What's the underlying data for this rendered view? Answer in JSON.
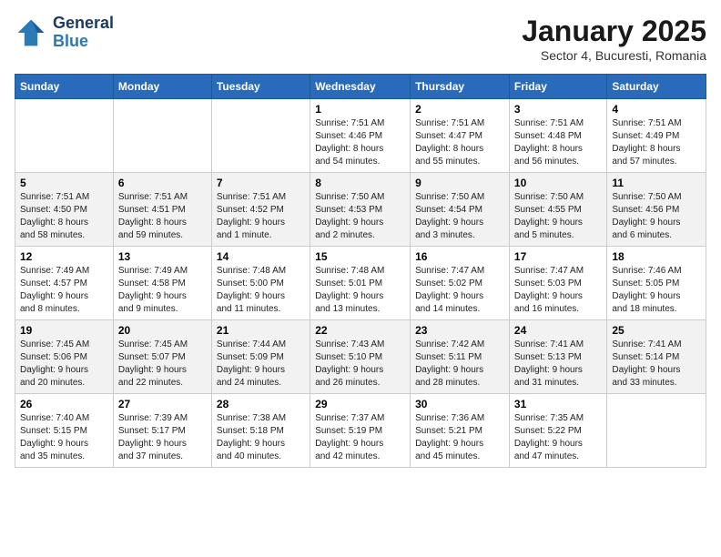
{
  "header": {
    "logo_line1": "General",
    "logo_line2": "Blue",
    "month": "January 2025",
    "location": "Sector 4, Bucuresti, Romania"
  },
  "weekdays": [
    "Sunday",
    "Monday",
    "Tuesday",
    "Wednesday",
    "Thursday",
    "Friday",
    "Saturday"
  ],
  "weeks": [
    [
      {
        "day": "",
        "info": ""
      },
      {
        "day": "",
        "info": ""
      },
      {
        "day": "",
        "info": ""
      },
      {
        "day": "1",
        "info": "Sunrise: 7:51 AM\nSunset: 4:46 PM\nDaylight: 8 hours\nand 54 minutes."
      },
      {
        "day": "2",
        "info": "Sunrise: 7:51 AM\nSunset: 4:47 PM\nDaylight: 8 hours\nand 55 minutes."
      },
      {
        "day": "3",
        "info": "Sunrise: 7:51 AM\nSunset: 4:48 PM\nDaylight: 8 hours\nand 56 minutes."
      },
      {
        "day": "4",
        "info": "Sunrise: 7:51 AM\nSunset: 4:49 PM\nDaylight: 8 hours\nand 57 minutes."
      }
    ],
    [
      {
        "day": "5",
        "info": "Sunrise: 7:51 AM\nSunset: 4:50 PM\nDaylight: 8 hours\nand 58 minutes."
      },
      {
        "day": "6",
        "info": "Sunrise: 7:51 AM\nSunset: 4:51 PM\nDaylight: 8 hours\nand 59 minutes."
      },
      {
        "day": "7",
        "info": "Sunrise: 7:51 AM\nSunset: 4:52 PM\nDaylight: 9 hours\nand 1 minute."
      },
      {
        "day": "8",
        "info": "Sunrise: 7:50 AM\nSunset: 4:53 PM\nDaylight: 9 hours\nand 2 minutes."
      },
      {
        "day": "9",
        "info": "Sunrise: 7:50 AM\nSunset: 4:54 PM\nDaylight: 9 hours\nand 3 minutes."
      },
      {
        "day": "10",
        "info": "Sunrise: 7:50 AM\nSunset: 4:55 PM\nDaylight: 9 hours\nand 5 minutes."
      },
      {
        "day": "11",
        "info": "Sunrise: 7:50 AM\nSunset: 4:56 PM\nDaylight: 9 hours\nand 6 minutes."
      }
    ],
    [
      {
        "day": "12",
        "info": "Sunrise: 7:49 AM\nSunset: 4:57 PM\nDaylight: 9 hours\nand 8 minutes."
      },
      {
        "day": "13",
        "info": "Sunrise: 7:49 AM\nSunset: 4:58 PM\nDaylight: 9 hours\nand 9 minutes."
      },
      {
        "day": "14",
        "info": "Sunrise: 7:48 AM\nSunset: 5:00 PM\nDaylight: 9 hours\nand 11 minutes."
      },
      {
        "day": "15",
        "info": "Sunrise: 7:48 AM\nSunset: 5:01 PM\nDaylight: 9 hours\nand 13 minutes."
      },
      {
        "day": "16",
        "info": "Sunrise: 7:47 AM\nSunset: 5:02 PM\nDaylight: 9 hours\nand 14 minutes."
      },
      {
        "day": "17",
        "info": "Sunrise: 7:47 AM\nSunset: 5:03 PM\nDaylight: 9 hours\nand 16 minutes."
      },
      {
        "day": "18",
        "info": "Sunrise: 7:46 AM\nSunset: 5:05 PM\nDaylight: 9 hours\nand 18 minutes."
      }
    ],
    [
      {
        "day": "19",
        "info": "Sunrise: 7:45 AM\nSunset: 5:06 PM\nDaylight: 9 hours\nand 20 minutes."
      },
      {
        "day": "20",
        "info": "Sunrise: 7:45 AM\nSunset: 5:07 PM\nDaylight: 9 hours\nand 22 minutes."
      },
      {
        "day": "21",
        "info": "Sunrise: 7:44 AM\nSunset: 5:09 PM\nDaylight: 9 hours\nand 24 minutes."
      },
      {
        "day": "22",
        "info": "Sunrise: 7:43 AM\nSunset: 5:10 PM\nDaylight: 9 hours\nand 26 minutes."
      },
      {
        "day": "23",
        "info": "Sunrise: 7:42 AM\nSunset: 5:11 PM\nDaylight: 9 hours\nand 28 minutes."
      },
      {
        "day": "24",
        "info": "Sunrise: 7:41 AM\nSunset: 5:13 PM\nDaylight: 9 hours\nand 31 minutes."
      },
      {
        "day": "25",
        "info": "Sunrise: 7:41 AM\nSunset: 5:14 PM\nDaylight: 9 hours\nand 33 minutes."
      }
    ],
    [
      {
        "day": "26",
        "info": "Sunrise: 7:40 AM\nSunset: 5:15 PM\nDaylight: 9 hours\nand 35 minutes."
      },
      {
        "day": "27",
        "info": "Sunrise: 7:39 AM\nSunset: 5:17 PM\nDaylight: 9 hours\nand 37 minutes."
      },
      {
        "day": "28",
        "info": "Sunrise: 7:38 AM\nSunset: 5:18 PM\nDaylight: 9 hours\nand 40 minutes."
      },
      {
        "day": "29",
        "info": "Sunrise: 7:37 AM\nSunset: 5:19 PM\nDaylight: 9 hours\nand 42 minutes."
      },
      {
        "day": "30",
        "info": "Sunrise: 7:36 AM\nSunset: 5:21 PM\nDaylight: 9 hours\nand 45 minutes."
      },
      {
        "day": "31",
        "info": "Sunrise: 7:35 AM\nSunset: 5:22 PM\nDaylight: 9 hours\nand 47 minutes."
      },
      {
        "day": "",
        "info": ""
      }
    ]
  ]
}
